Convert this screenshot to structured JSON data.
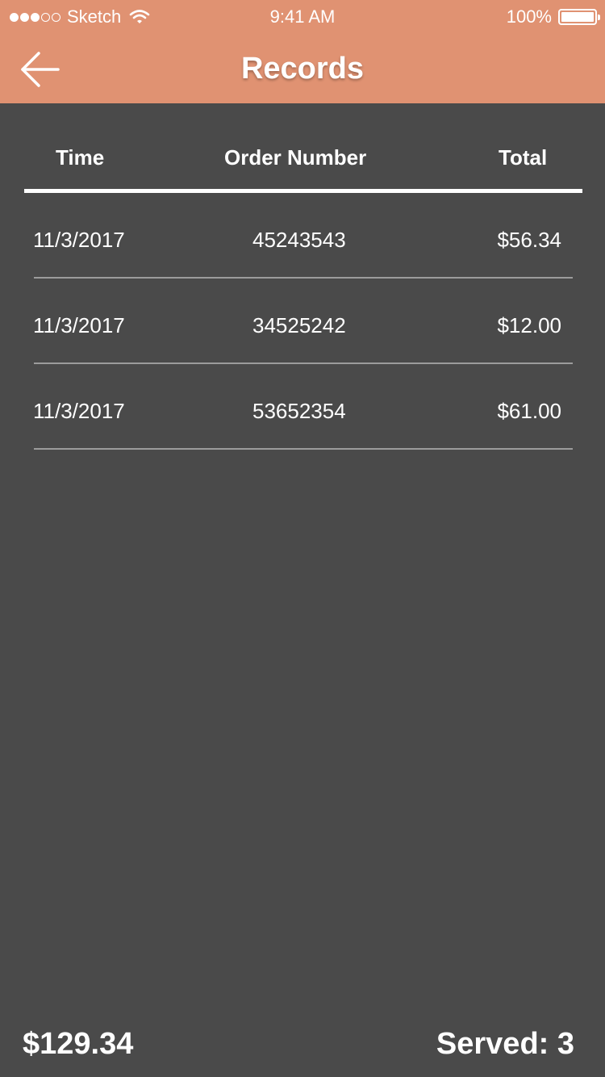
{
  "status_bar": {
    "carrier": "Sketch",
    "time": "9:41 AM",
    "battery_percent": "100%",
    "signal_dots_filled": 3,
    "signal_dots_total": 5
  },
  "nav": {
    "title": "Records",
    "back_icon": "arrow-left-icon"
  },
  "table": {
    "headers": {
      "time": "Time",
      "order_number": "Order Number",
      "total": "Total"
    },
    "rows": [
      {
        "time": "11/3/2017",
        "order_number": "45243543",
        "total": "$56.34"
      },
      {
        "time": "11/3/2017",
        "order_number": "34525242",
        "total": "$12.00"
      },
      {
        "time": "11/3/2017",
        "order_number": "53652354",
        "total": "$61.00"
      }
    ]
  },
  "footer": {
    "total": "$129.34",
    "served": "Served: 3"
  },
  "colors": {
    "accent": "#e09272",
    "background": "#4a4a4a",
    "separator": "#9c9c9c",
    "text": "#ffffff"
  }
}
